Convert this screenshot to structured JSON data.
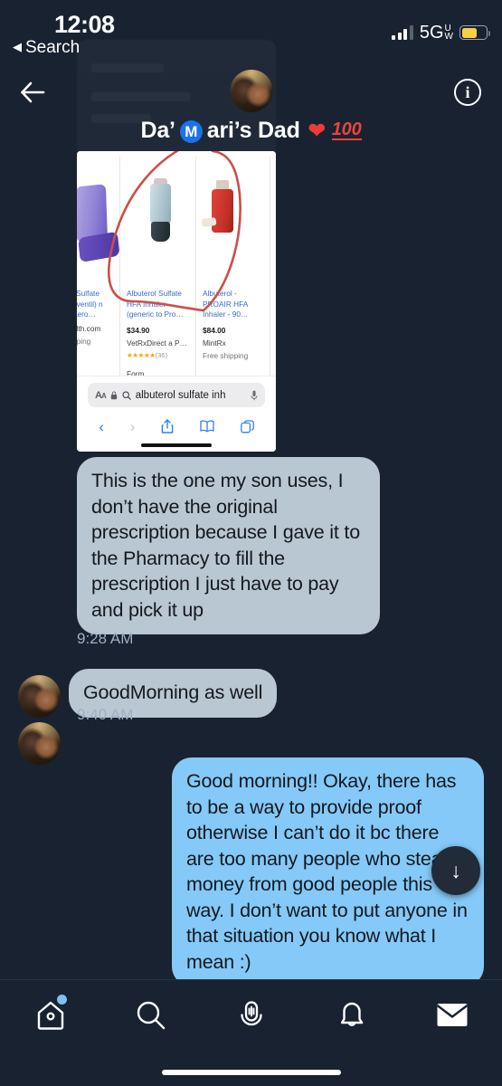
{
  "status_bar": {
    "time": "12:08",
    "back_label": "Search",
    "back_caret": "◀",
    "network": "5G",
    "network_sub_top": "U",
    "network_sub_bottom": "W",
    "signal_icon": "cellular-bars-icon",
    "battery_icon": "battery-low-power-icon",
    "battery_color": "#f7cf46"
  },
  "header": {
    "back_icon": "back-arrow-icon",
    "info_icon": "info-icon",
    "info_glyph": "i",
    "avatar_icon": "contact-avatar",
    "title_part1": "Da’",
    "title_emoji_m": "M",
    "title_part2": "ari’s Dad",
    "title_emoji_heart": "❤",
    "title_emoji_100": "100"
  },
  "attachment": {
    "name": "shared-screenshot-search-results",
    "cards": [
      {
        "title": "l Sulfate\noventil)\nn Aero…",
        "price": "",
        "merchant": "alth.com",
        "rating": "",
        "shipping": "pping",
        "form": ""
      },
      {
        "title": "Albuterol Sulfate HFA Inhaler (generic to Pro…",
        "price": "$34.90",
        "merchant": "VetRxDirect a P…",
        "rating_stars": "★★★★★",
        "rating_count": "(36)",
        "shipping": "",
        "form": "Form"
      },
      {
        "title": "Albuterol - PROAIR HFA Inhaler - 90…",
        "price": "$84.00",
        "merchant": "MintRx",
        "rating": "",
        "shipping": "Free shipping",
        "form": ""
      }
    ],
    "safari": {
      "aa_label": "A",
      "aa_label_small": "A",
      "lock_icon": "lock-icon",
      "search_icon": "search-icon",
      "url_text": "albuterol sulfate inh",
      "mic_icon": "microphone-icon",
      "back_icon": "browser-back-icon",
      "forward_icon": "browser-forward-icon",
      "share_icon": "share-icon",
      "bookmarks_icon": "book-icon",
      "tabs_icon": "tabs-icon"
    }
  },
  "messages": [
    {
      "id": "msg-incoming-1",
      "direction": "incoming",
      "text": "This is the one my son uses, I don’t have the original prescription because I gave it to the Pharmacy to fill the prescription I just have to pay and pick it up",
      "time": "9:28 AM"
    },
    {
      "id": "msg-incoming-2",
      "direction": "incoming",
      "text": "GoodMorning as well",
      "time": "9:40 AM"
    },
    {
      "id": "msg-outgoing-1",
      "direction": "outgoing",
      "text": "Good morning!! Okay, there has to be a way to provide proof otherwise I can’t do it bc there are too many people who steal money from good people this way. I don’t want to put anyone in that situation you know what I mean :)",
      "time": ""
    }
  ],
  "scroll_button": {
    "icon": "arrow-down-icon",
    "glyph": "↓"
  },
  "tabbar": {
    "items": [
      {
        "name": "tab-home",
        "icon": "home-icon",
        "badge": true
      },
      {
        "name": "tab-search",
        "icon": "search-icon",
        "badge": false
      },
      {
        "name": "tab-spaces",
        "icon": "spaces-microphone-icon",
        "badge": false
      },
      {
        "name": "tab-notifications",
        "icon": "bell-icon",
        "badge": false
      },
      {
        "name": "tab-messages",
        "icon": "envelope-icon",
        "badge": false
      }
    ]
  },
  "colors": {
    "background": "#192230",
    "incoming_bubble": "#b9c7d2",
    "outgoing_bubble": "#84c9f7",
    "accent_blue": "#7cc1f0",
    "timestamp": "#9fb0c2"
  }
}
